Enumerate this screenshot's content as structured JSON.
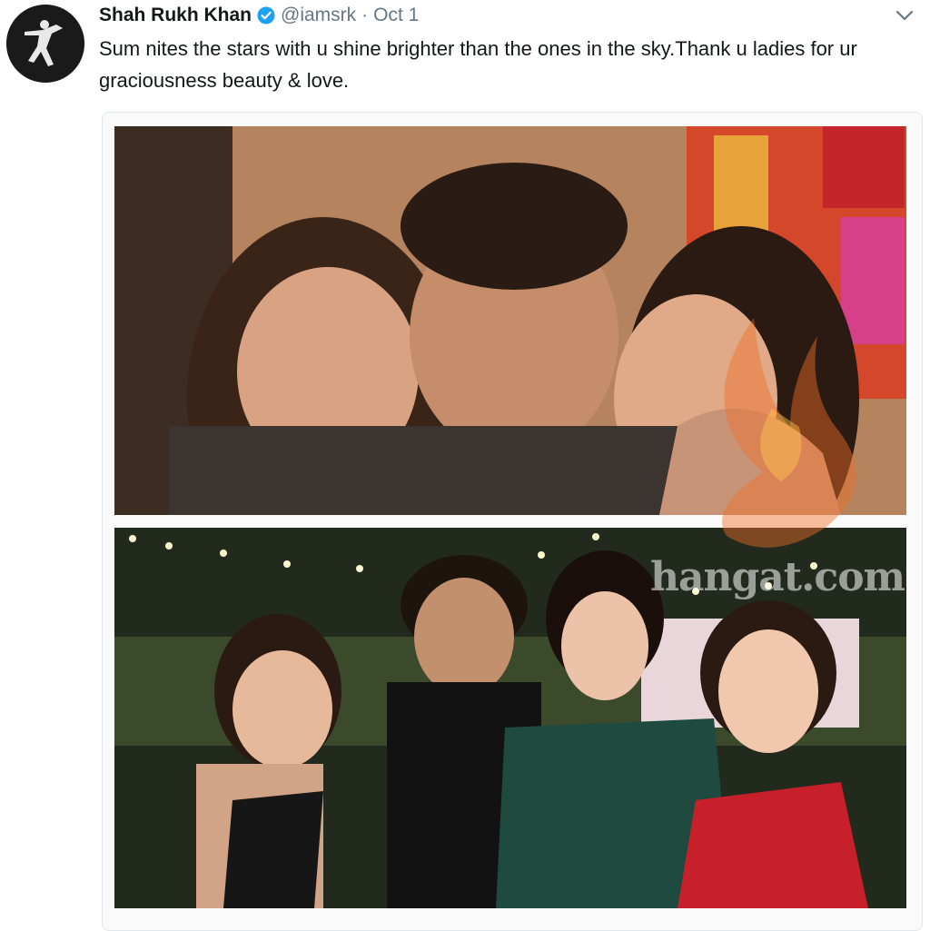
{
  "tweet": {
    "author_name": "Shah Rukh Khan",
    "handle": "@iamsrk",
    "separator": "·",
    "date": "Oct 1",
    "text": "Sum nites the stars with u shine brighter than the ones in the sky.Thank u ladies for ur graciousness beauty & love."
  },
  "icons": {
    "verified": "verified-badge-icon",
    "menu": "chevron-down-icon"
  },
  "media": {
    "watermark": "hangat.com"
  },
  "colors": {
    "verified_blue": "#1da1f2",
    "secondary_text": "#657786",
    "primary_text": "#14171a"
  }
}
